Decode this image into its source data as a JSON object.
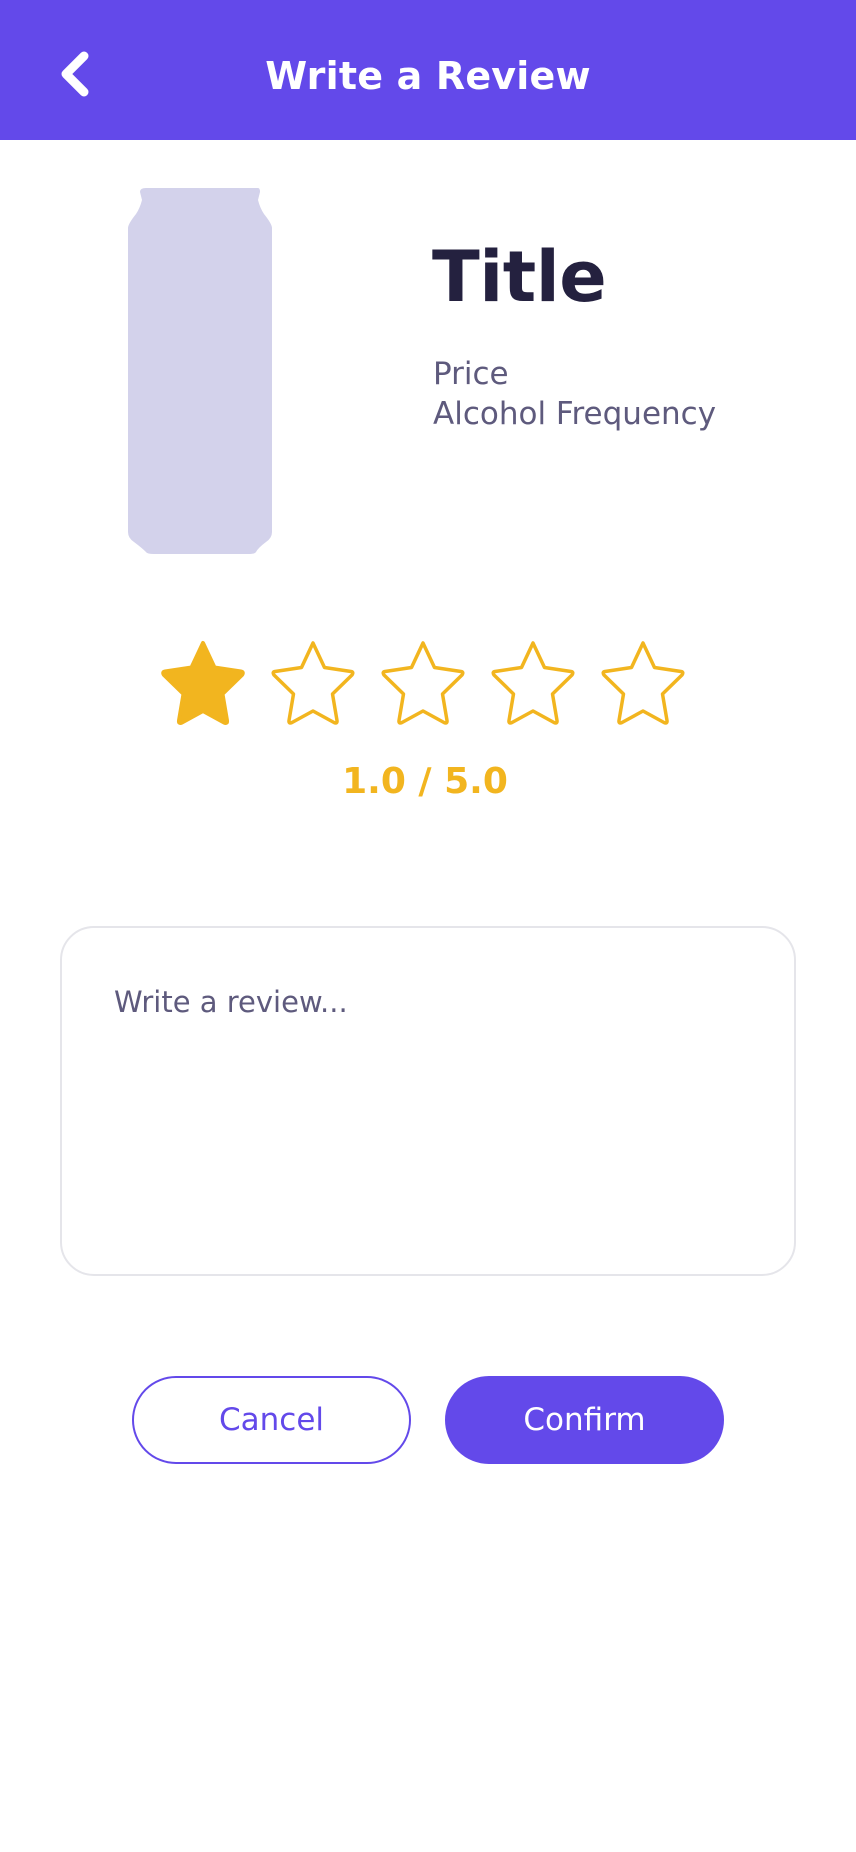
{
  "header": {
    "title": "Write a Review",
    "back_icon": "chevron-left-icon",
    "background_color": "#6349EA"
  },
  "product": {
    "image_icon": "can-silhouette",
    "image_color": "#D3D2EB",
    "title": "Title",
    "price_label": "Price",
    "alcohol_label": "Alcohol Frequency"
  },
  "rating": {
    "value": 1,
    "max": 5,
    "text": "1.0 / 5.0",
    "star_color": "#F2B51F",
    "star_icon": "star-icon"
  },
  "review": {
    "value": "",
    "placeholder": "Write a review..."
  },
  "buttons": {
    "cancel_label": "Cancel",
    "confirm_label": "Confirm",
    "accent_color": "#6349EA"
  }
}
